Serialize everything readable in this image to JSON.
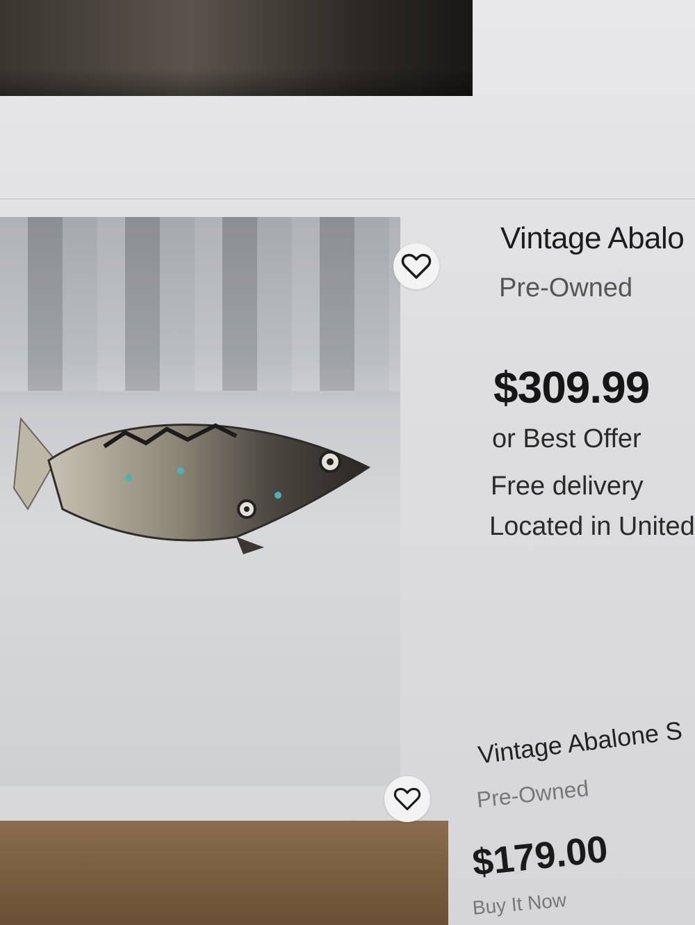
{
  "listings": [
    {
      "title": "Vintage Abalo",
      "condition": "Pre-Owned",
      "price": "$309.99",
      "offer": "or Best Offer",
      "delivery": "Free delivery",
      "location": "Located in United",
      "watch_icon": "heart-icon"
    },
    {
      "title": "Vintage Abalone S",
      "condition": "Pre-Owned",
      "price": "$179.00",
      "buy_format": "Buy It Now",
      "watch_icon": "heart-icon"
    }
  ]
}
